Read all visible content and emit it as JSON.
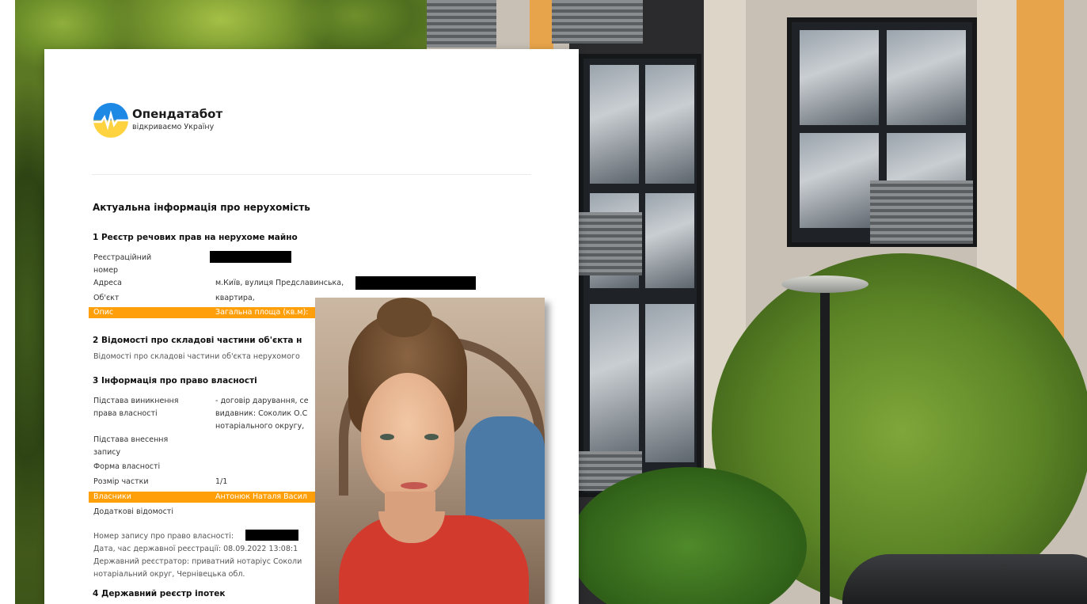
{
  "brand": {
    "name": "Опендатабот",
    "tagline": "відкриваємо Україну"
  },
  "document": {
    "title": "Актуальна інформація про нерухомість",
    "section1": {
      "heading": "1 Реєстр речових прав на нерухоме майно",
      "rows": [
        {
          "label": "Реєстраційний номер",
          "value": ""
        },
        {
          "label": "Адреса",
          "value": "м.Київ, вулиця Предславинська,"
        },
        {
          "label": "Об'єкт",
          "value": "квартира,"
        },
        {
          "label": "Опис",
          "value": "Загальна площа (кв.м):"
        }
      ]
    },
    "section2": {
      "heading": "2 Відомості про складові частини об'єкта н",
      "text": "Відомості про складові частини об'єкта нерухомого"
    },
    "section3": {
      "heading": "3 Інформація про право власності",
      "rows": [
        {
          "label": "Підстава виникнення права власності",
          "value": "- договір дарування, се видавник: Соколик О.С нотаріального округу,"
        },
        {
          "label": "Підстава внесення запису",
          "value": ""
        },
        {
          "label": "Форма власності",
          "value": ""
        },
        {
          "label": "Розмір частки",
          "value": "1/1"
        },
        {
          "label": "Власники",
          "value": "Антонюк Наталя Васил"
        },
        {
          "label": "Додаткові відомості",
          "value": ""
        }
      ],
      "record_number": "Номер запису про право власності:",
      "registration_date": "Дата, час державної реєстрації: 08.09.2022 13:08:1",
      "registrar": "Державний реєстратор: приватний нотаріус Соколи",
      "district": "нотаріальний округ, Чернівецька обл."
    },
    "section4": {
      "heading": "4 Державний реєстр іпотек"
    }
  },
  "colors": {
    "highlight": "#ff9f0a",
    "logo_blue": "#1e88e5",
    "logo_yellow": "#ffd23f"
  }
}
